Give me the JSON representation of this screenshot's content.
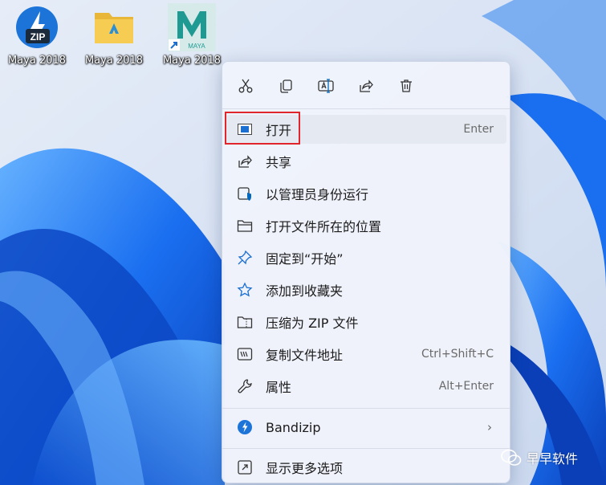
{
  "desktop": {
    "icons": [
      {
        "label": "Maya 2018",
        "icon": "bandizip-zip-icon"
      },
      {
        "label": "Maya 2018",
        "icon": "folder-icon"
      },
      {
        "label": "Maya 2018",
        "icon": "maya-app-icon"
      }
    ],
    "zip_badge_text": "ZIP",
    "maya_badge_text": "MAYA",
    "watermark": "早早软件"
  },
  "context_menu": {
    "toolbar": [
      {
        "name": "cut",
        "icon": "scissors-icon"
      },
      {
        "name": "copy",
        "icon": "copy-icon"
      },
      {
        "name": "rename",
        "icon": "rename-icon"
      },
      {
        "name": "share",
        "icon": "share-icon"
      },
      {
        "name": "delete",
        "icon": "trash-icon"
      }
    ],
    "items": [
      {
        "label": "打开",
        "shortcut": "Enter",
        "icon": "open-icon"
      },
      {
        "label": "共享",
        "shortcut": "",
        "icon": "share-icon"
      },
      {
        "label": "以管理员身份运行",
        "shortcut": "",
        "icon": "shield-icon"
      },
      {
        "label": "打开文件所在的位置",
        "shortcut": "",
        "icon": "folder-icon"
      },
      {
        "label": "固定到“开始”",
        "shortcut": "",
        "icon": "pin-icon"
      },
      {
        "label": "添加到收藏夹",
        "shortcut": "",
        "icon": "star-icon"
      },
      {
        "label": "压缩为 ZIP 文件",
        "shortcut": "",
        "icon": "zip-folder-icon"
      },
      {
        "label": "复制文件地址",
        "shortcut": "Ctrl+Shift+C",
        "icon": "copy-path-icon"
      },
      {
        "label": "属性",
        "shortcut": "Alt+Enter",
        "icon": "wrench-icon"
      }
    ],
    "bandizip": {
      "label": "Bandizip",
      "icon": "bandizip-icon"
    },
    "more": {
      "label": "显示更多选项",
      "icon": "more-options-icon"
    }
  },
  "colors": {
    "accent": "#0067c0",
    "highlight_box": "#e0262c",
    "wallpaper_blue": "#1b6fe8"
  }
}
